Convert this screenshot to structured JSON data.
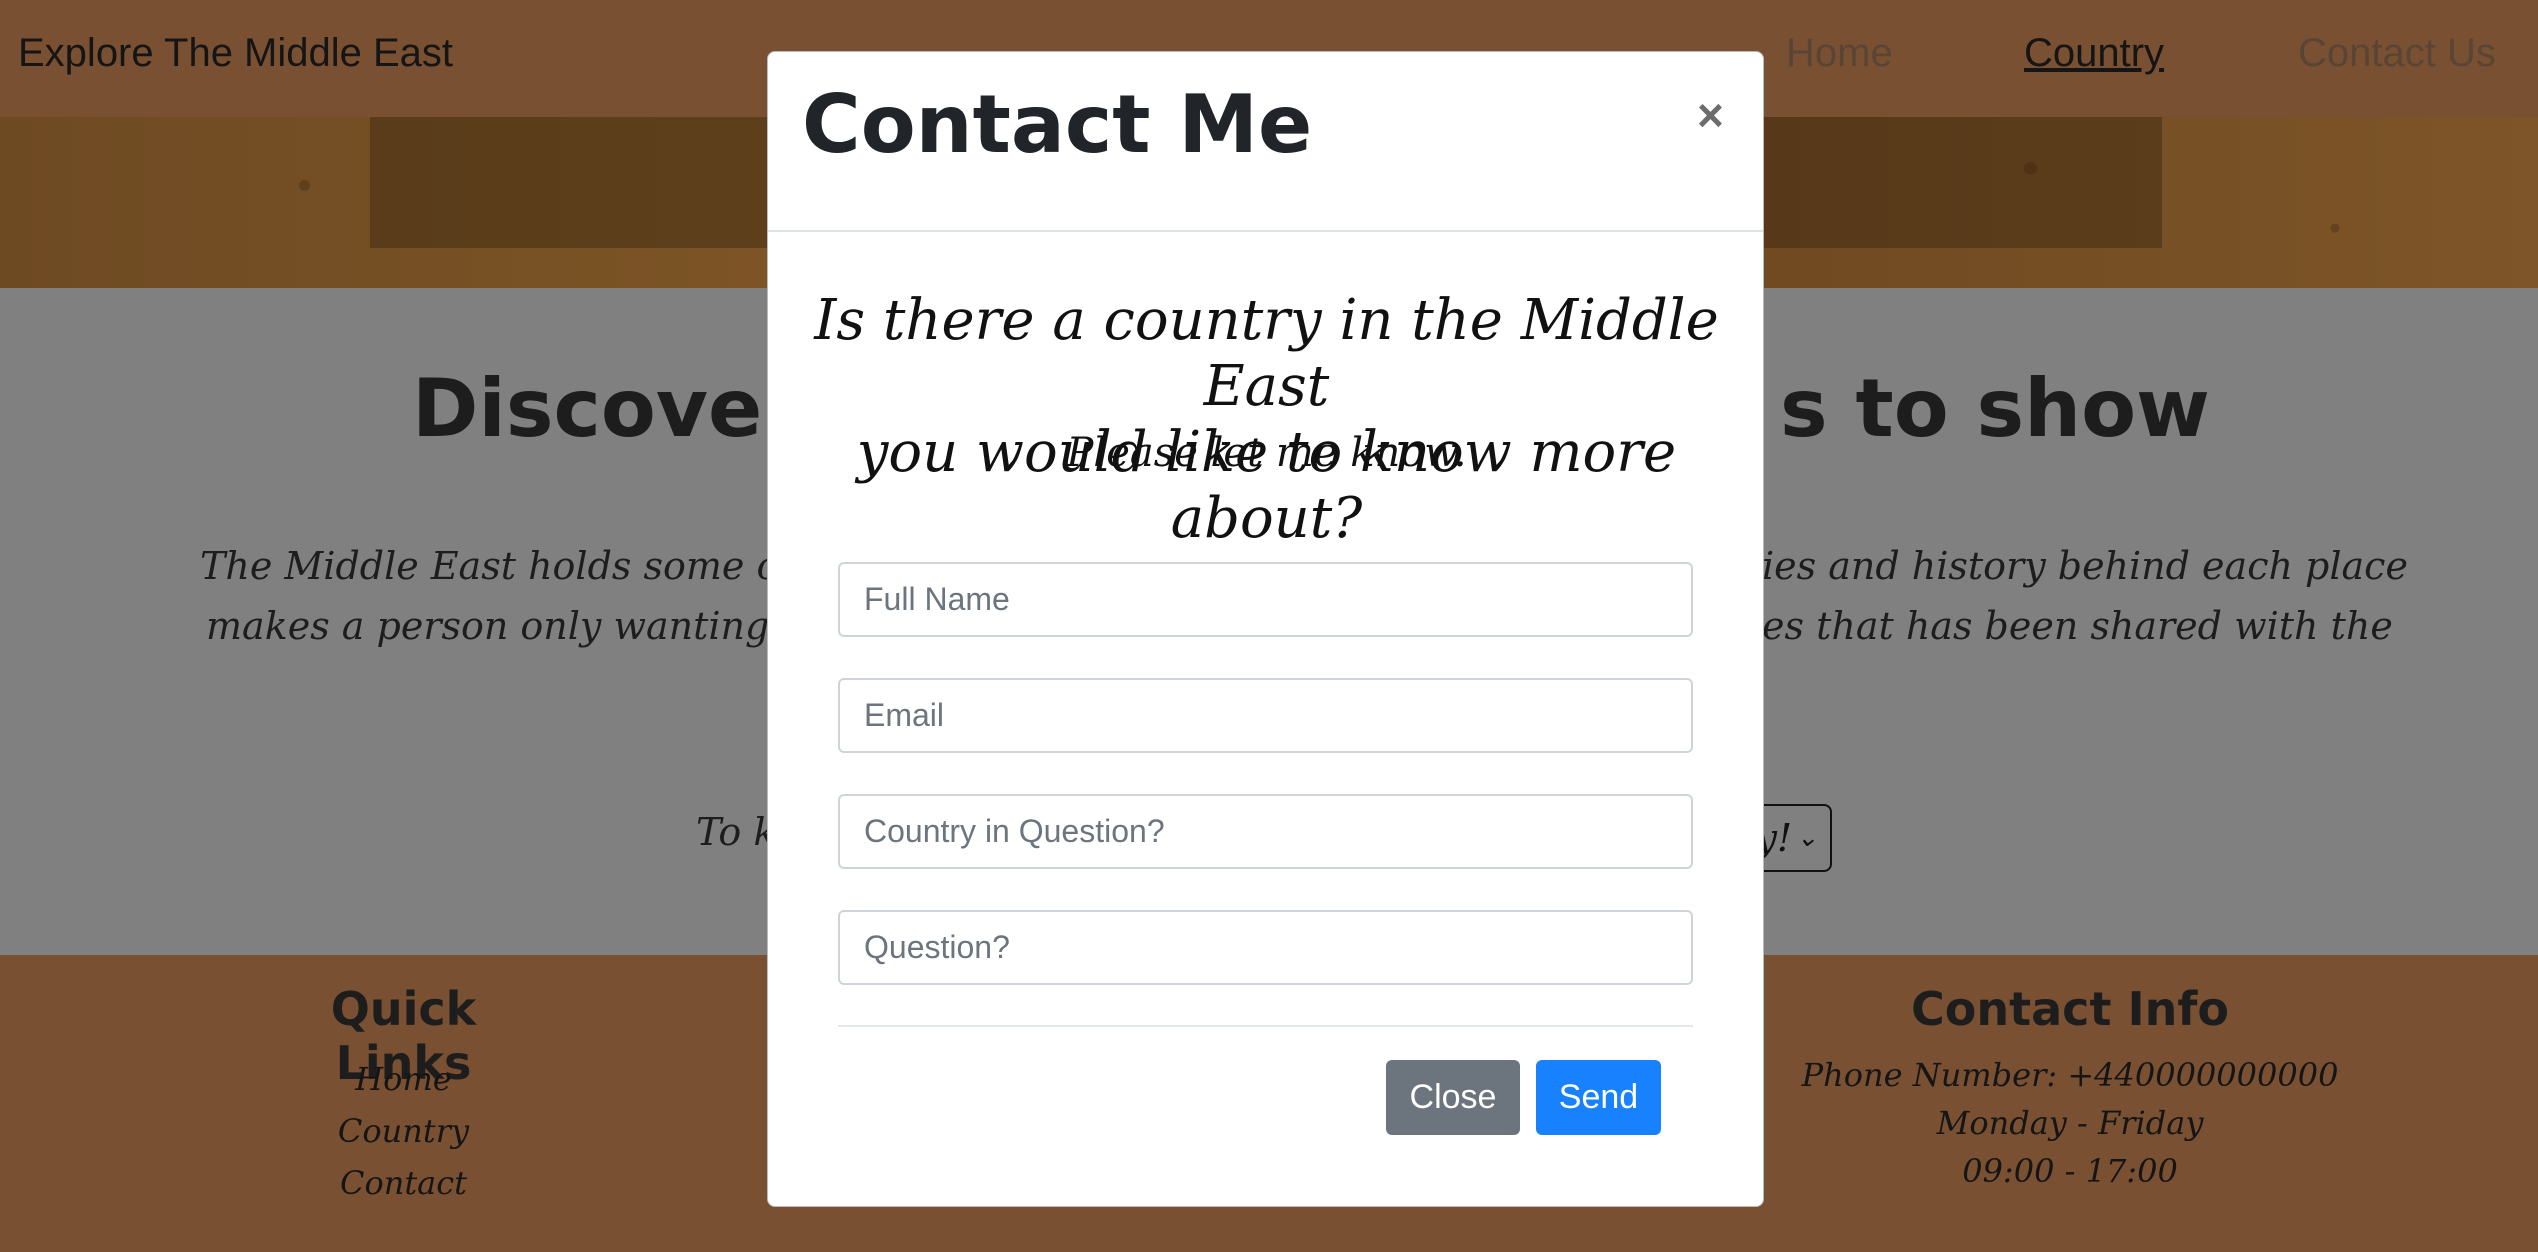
{
  "navbar": {
    "brand": "Explore The Middle East",
    "links": [
      "Home",
      "Country",
      "Contact Us"
    ]
  },
  "background": {
    "heading_left": "Discover",
    "heading_right": "s to show",
    "para_line1_left": "The Middle East holds some of th",
    "para_line1_right": "ies and history behind each place",
    "para_line2_left": "makes a person only wanting to",
    "para_line2_right": "es that has been shared with the",
    "select_prefix": "To k",
    "select_suffix": "ry!"
  },
  "footer": {
    "quick_links_title": "Quick Links",
    "quick_links": [
      "Home",
      "Country",
      "Contact"
    ],
    "contact_title": "Contact Info",
    "contact_lines": [
      "Phone Number: +440000000000",
      "Monday - Friday",
      "09:00 - 17:00"
    ]
  },
  "modal": {
    "title": "Contact Me",
    "close_symbol": "×",
    "question_line1": "Is there a country in the Middle East",
    "question_line2": "you would like to know more about?",
    "subtext": "Please let me know.",
    "fields": [
      {
        "placeholder": "Full Name"
      },
      {
        "placeholder": "Email"
      },
      {
        "placeholder": "Country in Question?"
      },
      {
        "placeholder": "Question?"
      }
    ],
    "close_label": "Close",
    "send_label": "Send"
  }
}
